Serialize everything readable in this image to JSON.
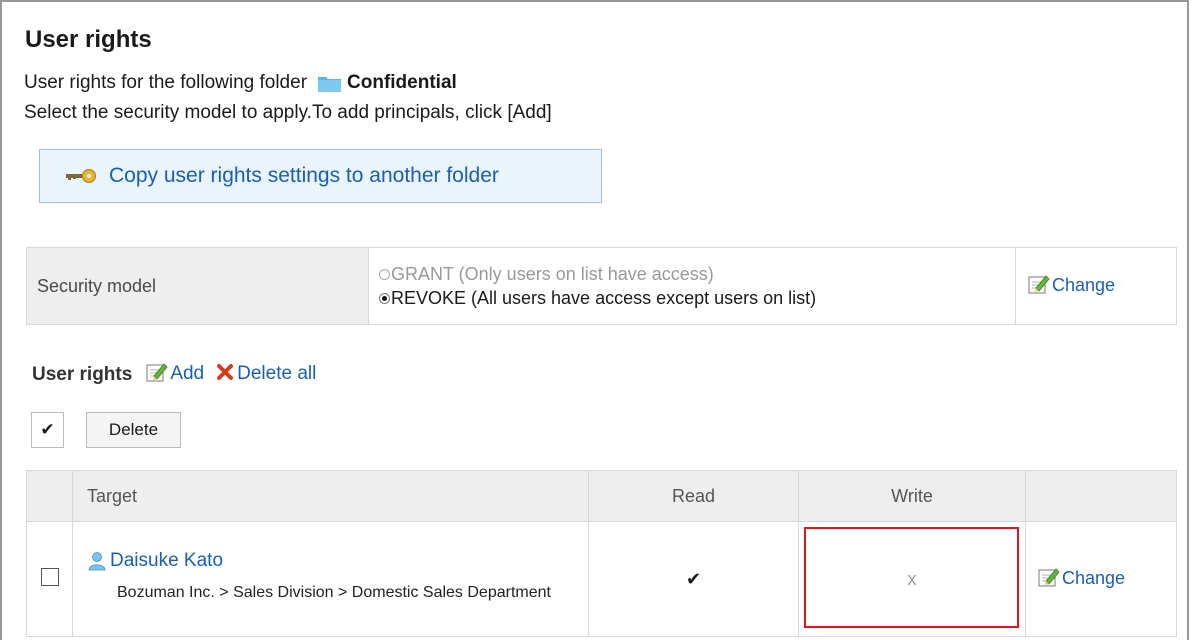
{
  "header": {
    "title": "User rights",
    "folder_line_prefix": "User rights for the following folder",
    "folder_name": "Confidential",
    "instruction": "Select the security model to apply.To add principals, click [Add]"
  },
  "copy_button": {
    "label": "Copy user rights settings to another folder"
  },
  "security_model": {
    "label": "Security model",
    "options": [
      {
        "label": "GRANT (Only users on list have access)",
        "selected": false
      },
      {
        "label": "REVOKE (All users have access except users on list)",
        "selected": true
      }
    ],
    "change_label": "Change"
  },
  "user_rights": {
    "heading": "User rights",
    "add_label": "Add",
    "delete_all_label": "Delete all",
    "check_all_glyph": "✔",
    "delete_label": "Delete",
    "columns": {
      "target": "Target",
      "read": "Read",
      "write": "Write"
    },
    "rows": [
      {
        "name": "Daisuke Kato",
        "department": "Bozuman Inc. > Sales Division > Domestic Sales Department",
        "read": "✔",
        "write": "x",
        "change_label": "Change"
      }
    ]
  },
  "colors": {
    "link": "#1a5eb8",
    "highlight_border": "#e0161d",
    "header_bg": "#eeeeee",
    "button_bg": "#eaf4fc"
  },
  "icons": [
    "folder-icon",
    "key-icon",
    "edit-icon",
    "delete-x-icon",
    "user-icon"
  ]
}
